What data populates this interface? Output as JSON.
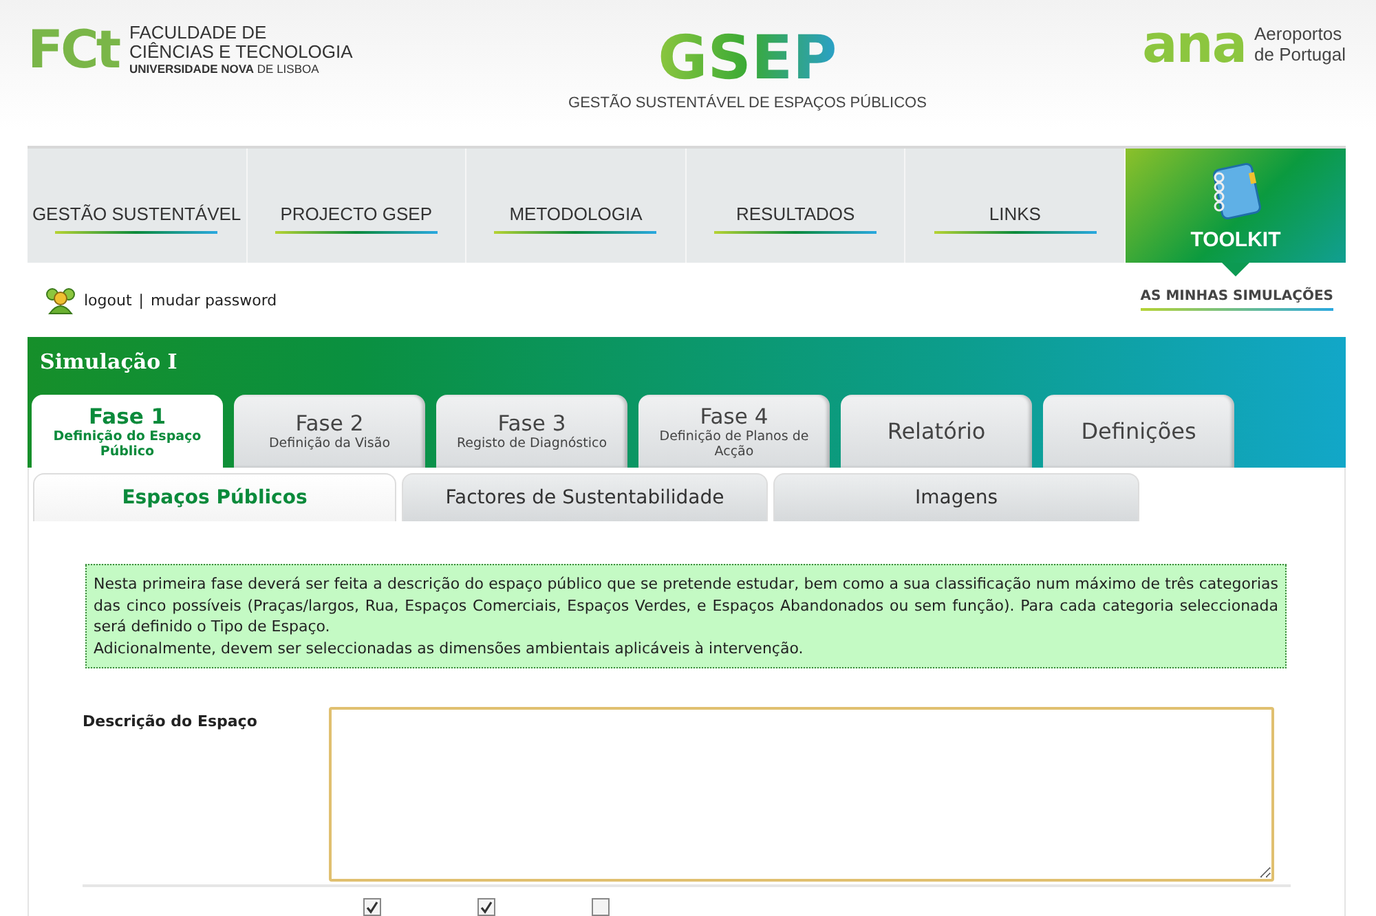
{
  "header": {
    "fct_logo": "FCt",
    "fct_name": [
      "FACULDADE DE",
      "CIÊNCIAS E TECNOLOGIA"
    ],
    "fct_university": "**UNIVERSIDADE NOVA** DE LISBOA",
    "gsep_logo": "GSEP",
    "gsep_subtitle": "GESTÃO SUSTENTÁVEL DE ESPAÇOS PÚBLICOS",
    "ana_logo": "ana",
    "ana_name": [
      "Aeroportos",
      "de Portugal"
    ]
  },
  "nav": {
    "items": [
      {
        "label": "GESTÃO SUSTENTÁVEL",
        "selected": false
      },
      {
        "label": "PROJECTO GSEP",
        "selected": false
      },
      {
        "label": "METODOLOGIA",
        "selected": false
      },
      {
        "label": "RESULTADOS",
        "selected": false
      },
      {
        "label": "LINKS",
        "selected": false
      }
    ],
    "toolkit": {
      "label": "TOOLKIT",
      "selected": true
    }
  },
  "user_bar": {
    "logout": "logout",
    "separator": "|",
    "change_password": "mudar password",
    "my_simulations": "AS MINHAS SIMULAÇÕES"
  },
  "simulation": {
    "title": "Simulação I",
    "phase_tabs": [
      {
        "title": "Fase 1",
        "subtitle": "Definição do Espaço Público",
        "selected": true
      },
      {
        "title": "Fase 2",
        "subtitle": "Definição da Visão",
        "selected": false
      },
      {
        "title": "Fase 3",
        "subtitle": "Registo de Diagnóstico",
        "selected": false
      },
      {
        "title": "Fase 4",
        "subtitle": "Definição de Planos de Acção",
        "selected": false
      },
      {
        "title": "Relatório",
        "selected": false
      },
      {
        "title": "Definições",
        "selected": false
      }
    ],
    "sub_tabs": [
      {
        "label": "Espaços Públicos",
        "selected": true
      },
      {
        "label": "Factores de Sustentabilidade",
        "selected": false
      },
      {
        "label": "Imagens",
        "selected": false
      }
    ]
  },
  "info": [
    "Nesta primeira fase deverá ser feita a descrição do espaço público que se pretende estudar, bem como a sua classificação num máximo de três categorias das cinco possíveis (Praças/largos, Rua, Espaços Comerciais, Espaços Verdes, e Espaços Abandonados ou sem função). Para cada categoria seleccionada será definido o Tipo de Espaço.",
    "Adicionalmente, devem ser seleccionadas as dimensões ambientais aplicáveis à intervenção."
  ],
  "form": {
    "description_label": "Descrição do Espaço",
    "dimension_checkboxes": [
      {
        "checked": true
      },
      {
        "checked": true
      },
      {
        "checked": false
      }
    ]
  }
}
